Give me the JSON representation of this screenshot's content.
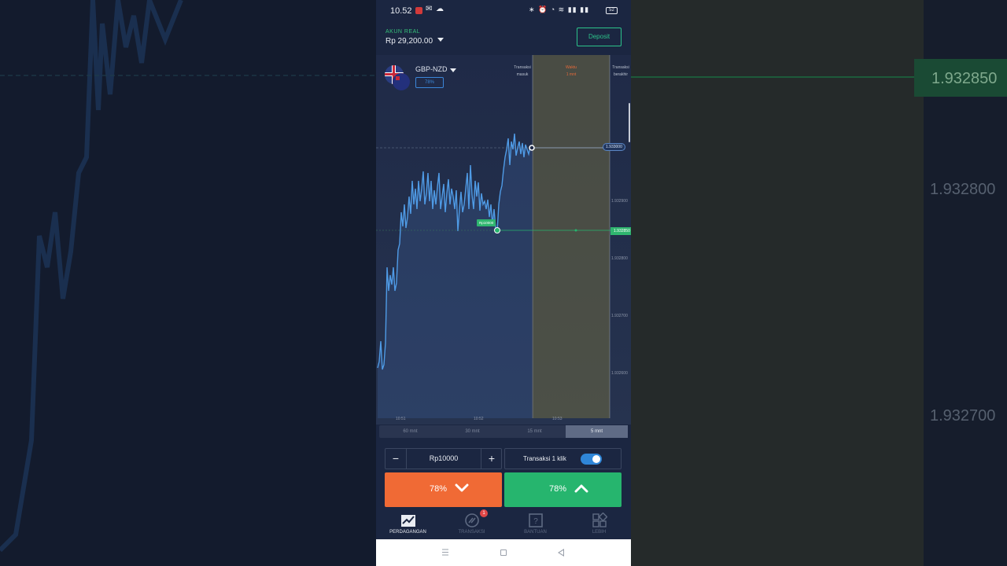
{
  "status_bar": {
    "time": "10.52",
    "battery": "52"
  },
  "account": {
    "label": "AKUN REAL",
    "balance": "Rp 29,200.00",
    "deposit_label": "Deposit"
  },
  "asset": {
    "pair": "GBP-NZD",
    "payout": "78%"
  },
  "chart_columns": {
    "entry_label": "Transaksi\nmasuk",
    "timer_label": "Waktu\n1 mnt",
    "close_label": "Transaksi\nberakhir"
  },
  "price_axis": {
    "current_price": "1.933000",
    "entry_price": "1.932850",
    "ticks": [
      "1.932900",
      "1.932800",
      "1.932700",
      "1.932600"
    ]
  },
  "time_axis": [
    "10:51",
    "10:52",
    "10:53"
  ],
  "trade_marker": "Rp10000",
  "timeframes": [
    {
      "label": "60 mnt",
      "active": false
    },
    {
      "label": "30 mnt",
      "active": false
    },
    {
      "label": "15 mnt",
      "active": false
    },
    {
      "label": "5 mnt",
      "active": true
    }
  ],
  "trade": {
    "amount": "Rp10000",
    "minus": "−",
    "plus": "+",
    "one_click_label": "Transaksi 1 klik",
    "one_click_enabled": true,
    "down_payout": "78%",
    "up_payout": "78%"
  },
  "nav": [
    {
      "label": "PERDAGANGAN",
      "active": true,
      "icon": "chart-trend-icon"
    },
    {
      "label": "TRANSAKSI",
      "active": false,
      "icon": "transactions-icon",
      "badge": "1"
    },
    {
      "label": "BANTUAN",
      "active": false,
      "icon": "help-icon"
    },
    {
      "label": "LEBIH",
      "active": false,
      "icon": "grid-more-icon"
    }
  ],
  "background": {
    "right_tag": "1.932850",
    "right_tick_1": "1.932800",
    "right_tick_2": "1.932700"
  },
  "colors": {
    "up": "#26b56e",
    "down": "#f06a35",
    "accent_blue": "#2f86d8",
    "line": "#4f9be6"
  }
}
